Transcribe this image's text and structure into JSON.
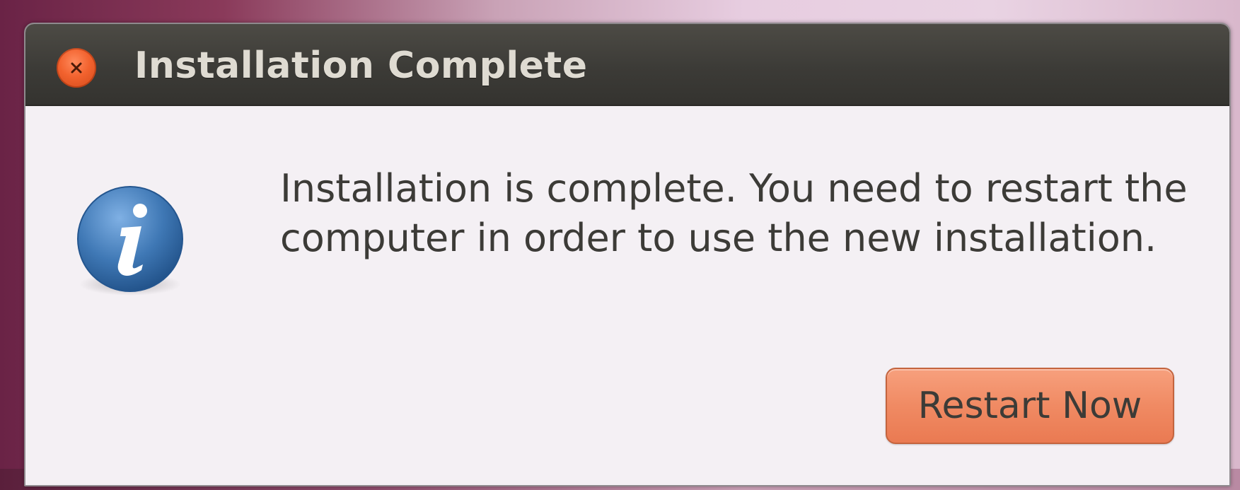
{
  "dialog": {
    "title": "Installation Complete",
    "message": "Installation is complete. You need to restart the computer in order to use the new installation.",
    "restart_button_label": "Restart Now",
    "close_icon": "close-icon",
    "info_icon": "info-icon"
  },
  "colors": {
    "titlebar": "#3c3b37",
    "close_button": "#f2622e",
    "primary_button": "#f08a63",
    "info_icon": "#3f78b5",
    "dialog_background": "#f4f0f4"
  }
}
